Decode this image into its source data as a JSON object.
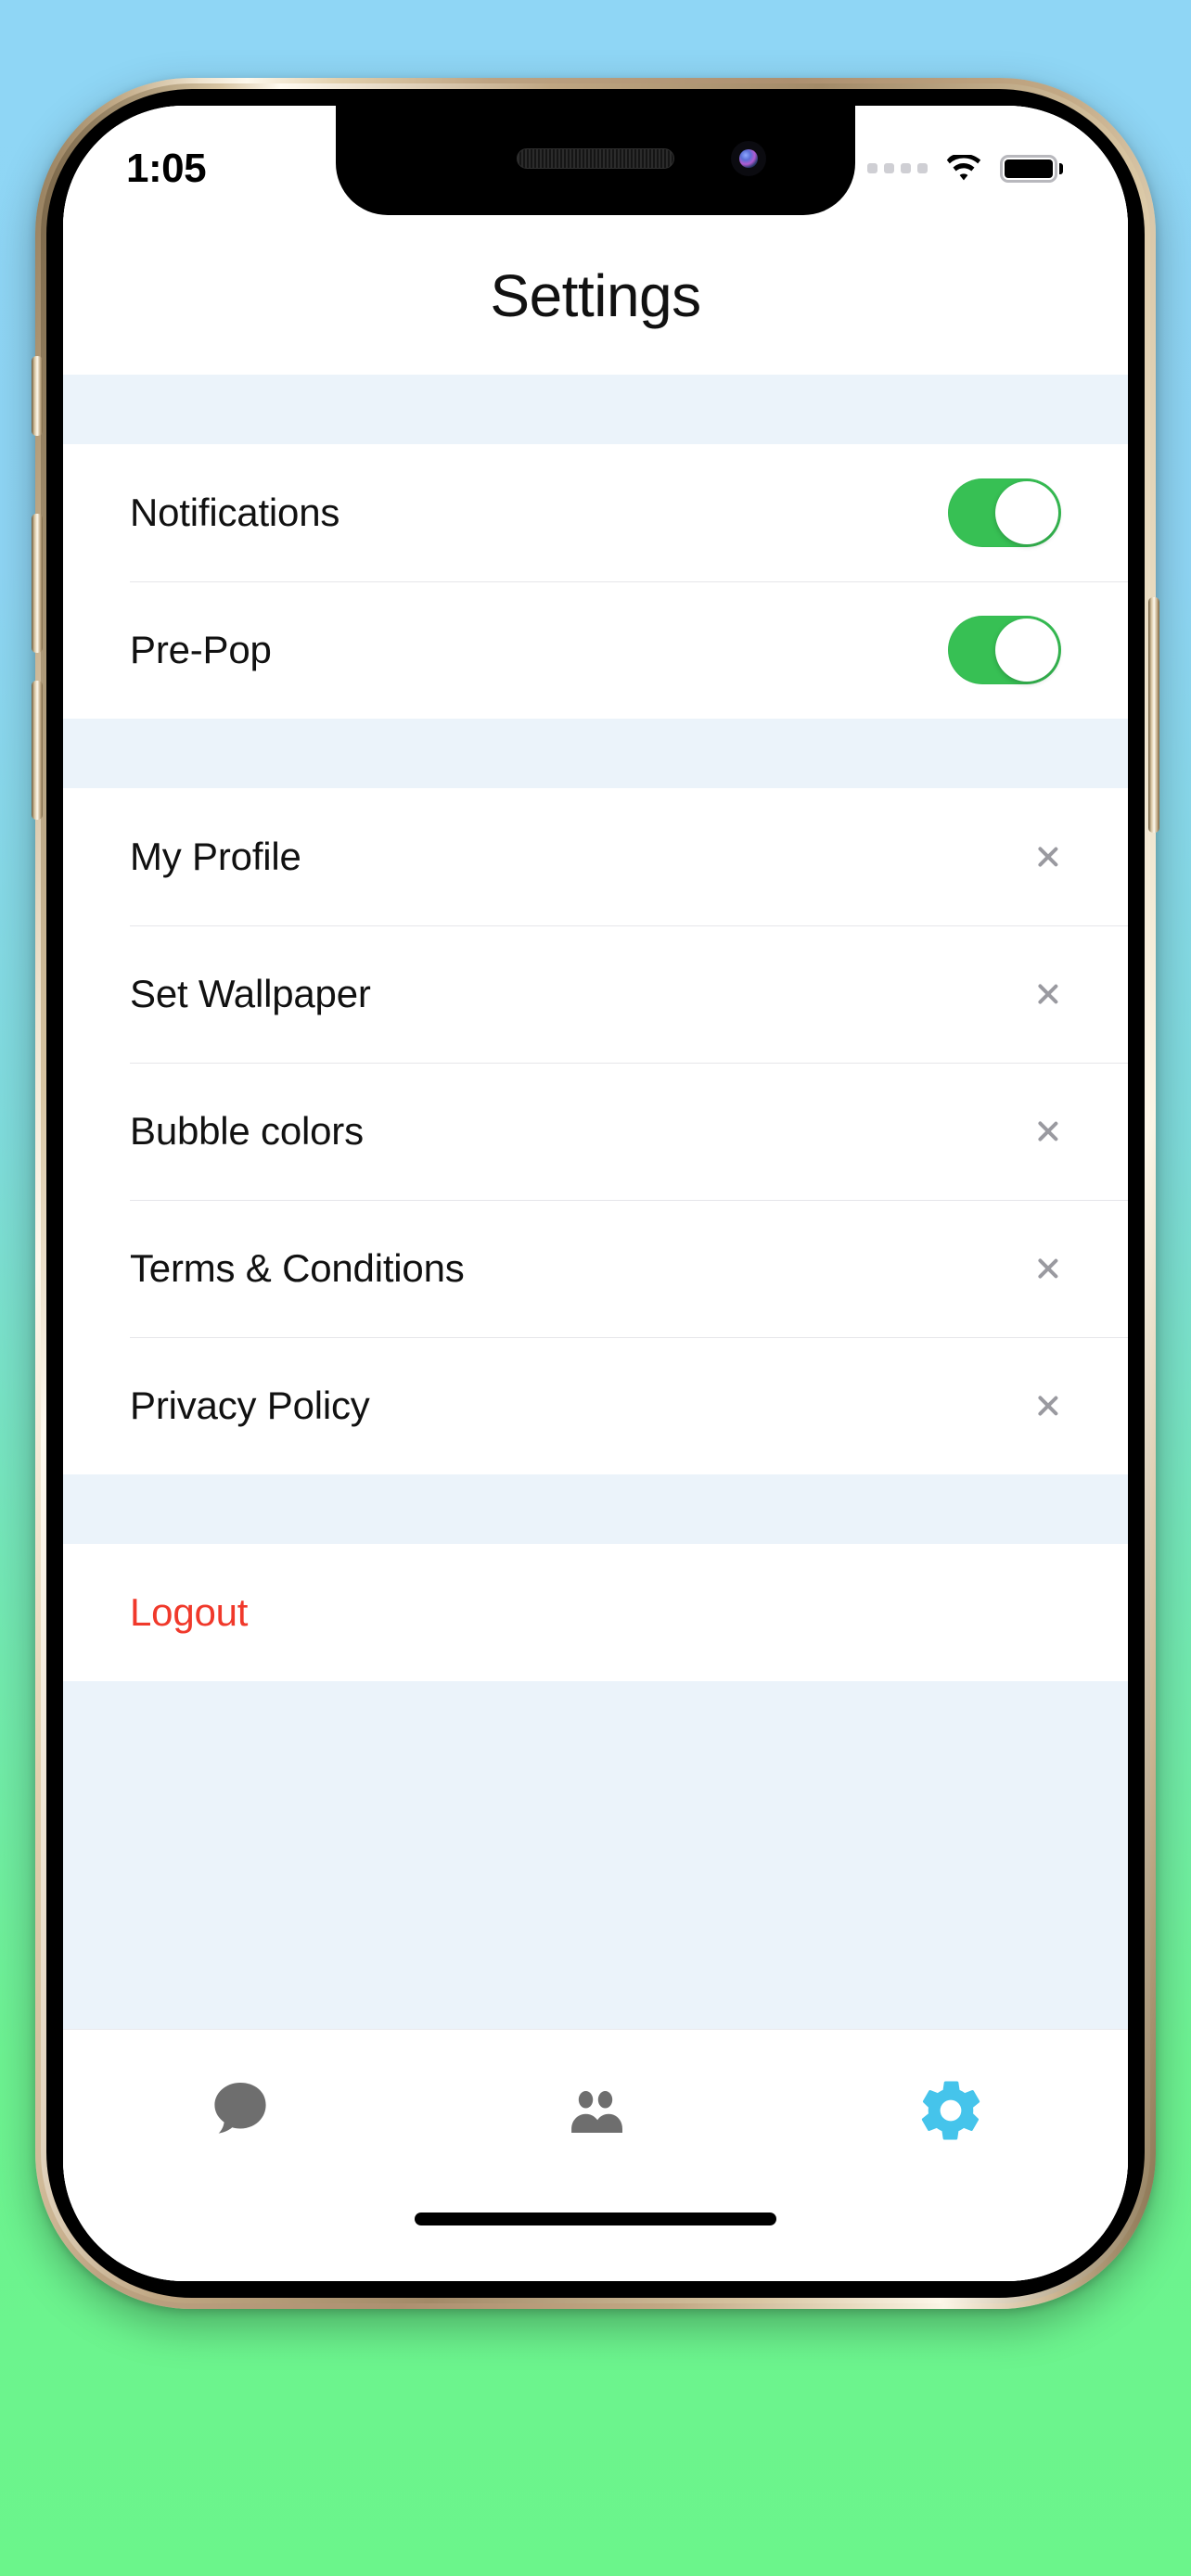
{
  "status_bar": {
    "time": "1:05",
    "signal_icon": "signal-dots-icon",
    "wifi_icon": "wifi-icon",
    "battery_icon": "battery-full-icon"
  },
  "header": {
    "title": "Settings"
  },
  "sections": [
    {
      "type": "toggles",
      "rows": [
        {
          "label": "Notifications",
          "control": "toggle",
          "value": "on"
        },
        {
          "label": "Pre-Pop",
          "control": "toggle",
          "value": "on"
        }
      ]
    },
    {
      "type": "links",
      "rows": [
        {
          "label": "My Profile",
          "control": "chevron"
        },
        {
          "label": "Set Wallpaper",
          "control": "chevron"
        },
        {
          "label": "Bubble colors",
          "control": "chevron"
        },
        {
          "label": "Terms & Conditions",
          "control": "chevron"
        },
        {
          "label": "Privacy Policy",
          "control": "chevron"
        }
      ]
    },
    {
      "type": "action",
      "rows": [
        {
          "label": "Logout",
          "control": "none",
          "style": "destructive"
        }
      ]
    }
  ],
  "tab_bar": {
    "tabs": [
      {
        "name": "chats",
        "icon": "chat-bubble-icon",
        "active": false
      },
      {
        "name": "contacts",
        "icon": "people-icon",
        "active": false
      },
      {
        "name": "settings",
        "icon": "gear-icon",
        "active": true
      }
    ]
  },
  "colors": {
    "toggle_on": "#37C054",
    "destructive": "#F0392B",
    "tab_active": "#45C4EB",
    "tab_inactive": "#6E6E6E",
    "section_gap": "#EBF3FA",
    "chevron": "#9A9AA0"
  }
}
